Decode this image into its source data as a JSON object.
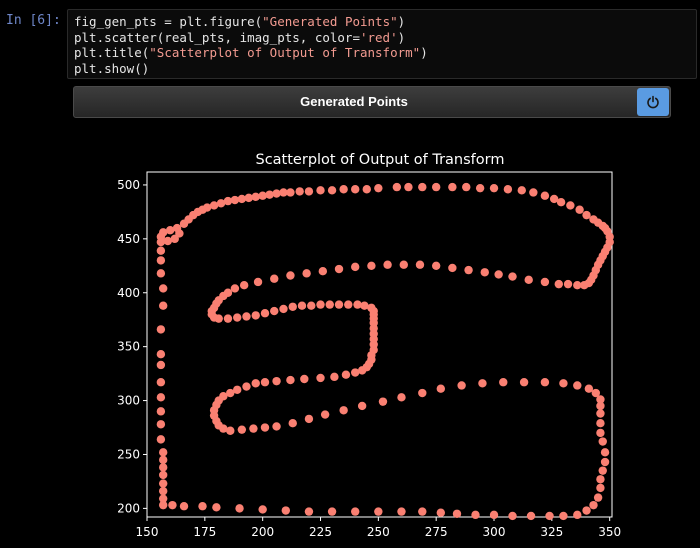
{
  "cell": {
    "prompt": "In [6]:",
    "lines": [
      [
        {
          "t": "fig_gen_pts = plt.figure(",
          "c": "kw"
        },
        {
          "t": "\"Generated Points\"",
          "c": "str"
        },
        {
          "t": ")",
          "c": "kw"
        }
      ],
      [
        {
          "t": "plt.scatter(real_pts, imag_pts, color=",
          "c": "kw"
        },
        {
          "t": "'red'",
          "c": "str"
        },
        {
          "t": ")",
          "c": "kw"
        }
      ],
      [
        {
          "t": "plt.title(",
          "c": "kw"
        },
        {
          "t": "\"Scatterplot of Output of Transform\"",
          "c": "str"
        },
        {
          "t": ")",
          "c": "kw"
        }
      ],
      [
        {
          "t": "plt.show()",
          "c": "kw"
        }
      ]
    ]
  },
  "figure": {
    "header_title": "Generated Points",
    "power_icon": "power-icon"
  },
  "chart_data": {
    "type": "scatter",
    "title": "Scatterplot of Output of Transform",
    "xlabel": "",
    "ylabel": "",
    "xlim": [
      150,
      351
    ],
    "ylim": [
      192,
      512
    ],
    "x_ticks": [
      150,
      175,
      200,
      225,
      250,
      275,
      300,
      325,
      350
    ],
    "y_ticks": [
      200,
      250,
      300,
      350,
      400,
      450,
      500
    ],
    "grid": false,
    "marker_color": "#fa8072",
    "background": "#000000",
    "axis_color": "#ffffff",
    "points": [
      [
        157,
        203
      ],
      [
        157,
        209
      ],
      [
        157,
        216
      ],
      [
        157,
        223
      ],
      [
        157,
        231
      ],
      [
        157,
        238
      ],
      [
        157,
        245
      ],
      [
        157,
        252
      ],
      [
        156,
        264
      ],
      [
        156,
        278
      ],
      [
        156,
        290
      ],
      [
        156,
        303
      ],
      [
        156,
        317
      ],
      [
        156,
        333
      ],
      [
        156,
        343
      ],
      [
        156,
        366
      ],
      [
        157,
        388
      ],
      [
        157,
        404
      ],
      [
        156,
        418
      ],
      [
        156,
        430
      ],
      [
        156,
        439
      ],
      [
        156,
        447
      ],
      [
        156,
        452
      ],
      [
        157,
        456
      ],
      [
        159,
        448
      ],
      [
        160,
        458
      ],
      [
        162,
        450
      ],
      [
        163,
        460
      ],
      [
        164,
        455
      ],
      [
        166,
        464
      ],
      [
        168,
        468
      ],
      [
        170,
        472
      ],
      [
        172,
        475
      ],
      [
        174,
        477
      ],
      [
        176,
        479
      ],
      [
        179,
        481
      ],
      [
        182,
        483
      ],
      [
        185,
        485
      ],
      [
        188,
        486
      ],
      [
        191,
        487
      ],
      [
        194,
        488
      ],
      [
        197,
        489
      ],
      [
        200,
        490
      ],
      [
        203,
        491
      ],
      [
        206,
        492
      ],
      [
        209,
        493
      ],
      [
        212,
        493
      ],
      [
        216,
        494
      ],
      [
        220,
        494
      ],
      [
        225,
        495
      ],
      [
        230,
        495
      ],
      [
        235,
        496
      ],
      [
        240,
        496
      ],
      [
        245,
        496
      ],
      [
        250,
        497
      ],
      [
        258,
        498
      ],
      [
        263,
        498
      ],
      [
        269,
        498
      ],
      [
        275,
        498
      ],
      [
        282,
        498
      ],
      [
        288,
        498
      ],
      [
        294,
        497
      ],
      [
        300,
        497
      ],
      [
        306,
        496
      ],
      [
        312,
        495
      ],
      [
        317,
        493
      ],
      [
        322,
        490
      ],
      [
        326,
        487
      ],
      [
        329,
        484
      ],
      [
        333,
        481
      ],
      [
        337,
        477
      ],
      [
        340,
        472
      ],
      [
        343,
        468
      ],
      [
        345,
        465
      ],
      [
        347,
        462
      ],
      [
        348,
        460
      ],
      [
        349,
        457
      ],
      [
        350,
        452
      ],
      [
        350,
        447
      ],
      [
        349,
        442
      ],
      [
        348,
        438
      ],
      [
        347,
        434
      ],
      [
        346,
        430
      ],
      [
        345,
        426
      ],
      [
        344,
        421
      ],
      [
        343,
        416
      ],
      [
        342,
        412
      ],
      [
        341,
        409
      ],
      [
        339,
        407
      ],
      [
        336,
        407
      ],
      [
        332,
        408
      ],
      [
        328,
        408
      ],
      [
        322,
        410
      ],
      [
        315,
        412
      ],
      [
        308,
        415
      ],
      [
        302,
        417
      ],
      [
        296,
        419
      ],
      [
        289,
        421
      ],
      [
        282,
        423
      ],
      [
        275,
        425
      ],
      [
        268,
        426
      ],
      [
        261,
        426
      ],
      [
        254,
        426
      ],
      [
        247,
        425
      ],
      [
        240,
        424
      ],
      [
        233,
        422
      ],
      [
        226,
        420
      ],
      [
        219,
        418
      ],
      [
        212,
        416
      ],
      [
        205,
        413
      ],
      [
        198,
        410
      ],
      [
        192,
        407
      ],
      [
        188,
        404
      ],
      [
        185,
        400
      ],
      [
        183,
        397
      ],
      [
        181,
        393
      ],
      [
        180,
        390
      ],
      [
        179,
        386
      ],
      [
        178,
        383
      ],
      [
        178,
        380
      ],
      [
        179,
        377
      ],
      [
        181,
        376
      ],
      [
        185,
        376
      ],
      [
        189,
        377
      ],
      [
        193,
        378
      ],
      [
        197,
        379
      ],
      [
        201,
        381
      ],
      [
        205,
        383
      ],
      [
        209,
        385
      ],
      [
        213,
        387
      ],
      [
        217,
        388
      ],
      [
        221,
        388
      ],
      [
        225,
        389
      ],
      [
        229,
        389
      ],
      [
        233,
        389
      ],
      [
        237,
        389
      ],
      [
        241,
        389
      ],
      [
        244,
        388
      ],
      [
        247,
        386
      ],
      [
        248,
        383
      ],
      [
        248,
        380
      ],
      [
        248,
        376
      ],
      [
        248,
        372
      ],
      [
        248,
        367
      ],
      [
        248,
        362
      ],
      [
        248,
        357
      ],
      [
        248,
        352
      ],
      [
        248,
        347
      ],
      [
        247,
        342
      ],
      [
        247,
        338
      ],
      [
        246,
        334
      ],
      [
        245,
        331
      ],
      [
        243,
        328
      ],
      [
        240,
        326
      ],
      [
        236,
        324
      ],
      [
        231,
        322
      ],
      [
        225,
        321
      ],
      [
        218,
        320
      ],
      [
        212,
        319
      ],
      [
        206,
        318
      ],
      [
        201,
        317
      ],
      [
        197,
        316
      ],
      [
        193,
        313
      ],
      [
        189,
        310
      ],
      [
        186,
        307
      ],
      [
        183,
        304
      ],
      [
        181,
        300
      ],
      [
        180,
        296
      ],
      [
        179,
        291
      ],
      [
        179,
        286
      ],
      [
        180,
        281
      ],
      [
        181,
        277
      ],
      [
        183,
        274
      ],
      [
        186,
        272
      ],
      [
        191,
        273
      ],
      [
        196,
        274
      ],
      [
        201,
        275
      ],
      [
        206,
        276
      ],
      [
        213,
        279
      ],
      [
        220,
        283
      ],
      [
        227,
        287
      ],
      [
        235,
        291
      ],
      [
        243,
        295
      ],
      [
        252,
        299
      ],
      [
        260,
        303
      ],
      [
        269,
        307
      ],
      [
        277,
        311
      ],
      [
        286,
        314
      ],
      [
        295,
        316
      ],
      [
        304,
        317
      ],
      [
        313,
        317
      ],
      [
        322,
        317
      ],
      [
        330,
        316
      ],
      [
        336,
        314
      ],
      [
        341,
        311
      ],
      [
        344,
        307
      ],
      [
        346,
        301
      ],
      [
        346,
        295
      ],
      [
        346,
        288
      ],
      [
        346,
        279
      ],
      [
        346,
        270
      ],
      [
        347,
        262
      ],
      [
        348,
        252
      ],
      [
        348,
        243
      ],
      [
        347,
        235
      ],
      [
        346,
        227
      ],
      [
        346,
        219
      ],
      [
        345,
        210
      ],
      [
        343,
        203
      ],
      [
        340,
        198
      ],
      [
        336,
        194
      ],
      [
        330,
        193
      ],
      [
        324,
        193
      ],
      [
        316,
        193
      ],
      [
        308,
        193
      ],
      [
        300,
        194
      ],
      [
        292,
        194
      ],
      [
        284,
        195
      ],
      [
        277,
        196
      ],
      [
        269,
        197
      ],
      [
        260,
        197
      ],
      [
        250,
        197
      ],
      [
        240,
        197
      ],
      [
        230,
        197
      ],
      [
        220,
        197
      ],
      [
        210,
        198
      ],
      [
        200,
        199
      ],
      [
        190,
        200
      ],
      [
        180,
        201
      ],
      [
        174,
        202
      ],
      [
        166,
        202
      ],
      [
        161,
        203
      ]
    ]
  }
}
